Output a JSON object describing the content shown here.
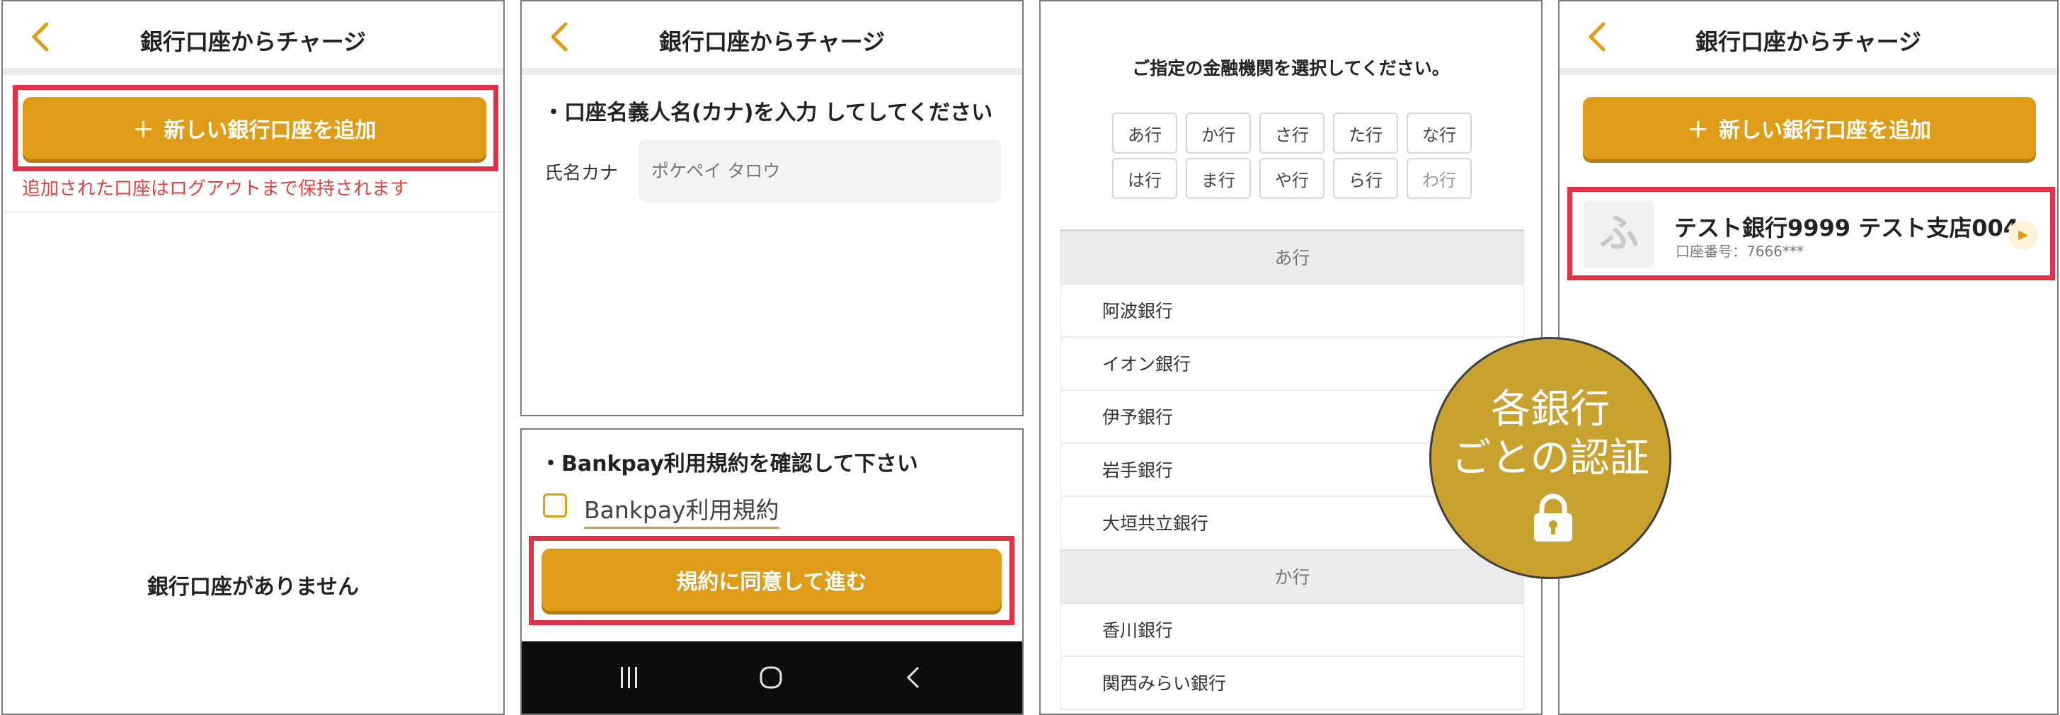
{
  "screen1": {
    "title": "銀行口座からチャージ",
    "add_button": "新しい銀行口座を追加",
    "add_icon": "＋",
    "note": "追加された口座はログアウトまで保持されます",
    "empty_message": "銀行口座がありません"
  },
  "screen2": {
    "title": "銀行口座からチャージ",
    "name_instruction": "・口座名義人名(カナ)を入力 してしてください",
    "name_label": "氏名カナ",
    "name_placeholder": "ポケペイ タロウ",
    "terms_instruction": "・Bankpay利用規約を確認して下さい",
    "terms_link": "Bankpay利用規約",
    "agree_button": "規約に同意して進む",
    "nav": {
      "recent": "|||",
      "home": "O",
      "back": "<"
    }
  },
  "screen3": {
    "prompt": "ご指定の金融機関を選択してください。",
    "kana_row1": [
      "あ行",
      "か行",
      "さ行",
      "た行",
      "な行"
    ],
    "kana_row2": [
      "は行",
      "ま行",
      "や行",
      "ら行",
      "わ行"
    ],
    "section_a": "あ行",
    "banks_a": [
      "阿波銀行",
      "イオン銀行",
      "伊予銀行",
      "岩手銀行",
      "大垣共立銀行"
    ],
    "section_ka": "か行",
    "banks_ka": [
      "香川銀行",
      "関西みらい銀行"
    ]
  },
  "badge": {
    "line1": "各銀行",
    "line2": "ごとの認証"
  },
  "screen4": {
    "title": "銀行口座からチャージ",
    "add_button": "新しい銀行口座を追加",
    "add_icon": "＋",
    "account_logo": "ふ",
    "account_name": "テスト銀行9999 テスト支店004",
    "account_number": "口座番号：7666***",
    "arrow": "▶"
  },
  "colors": {
    "accent": "#df9c18",
    "highlight_frame": "#e03247",
    "badge": "#c9a12e",
    "note_text": "#e04242"
  }
}
